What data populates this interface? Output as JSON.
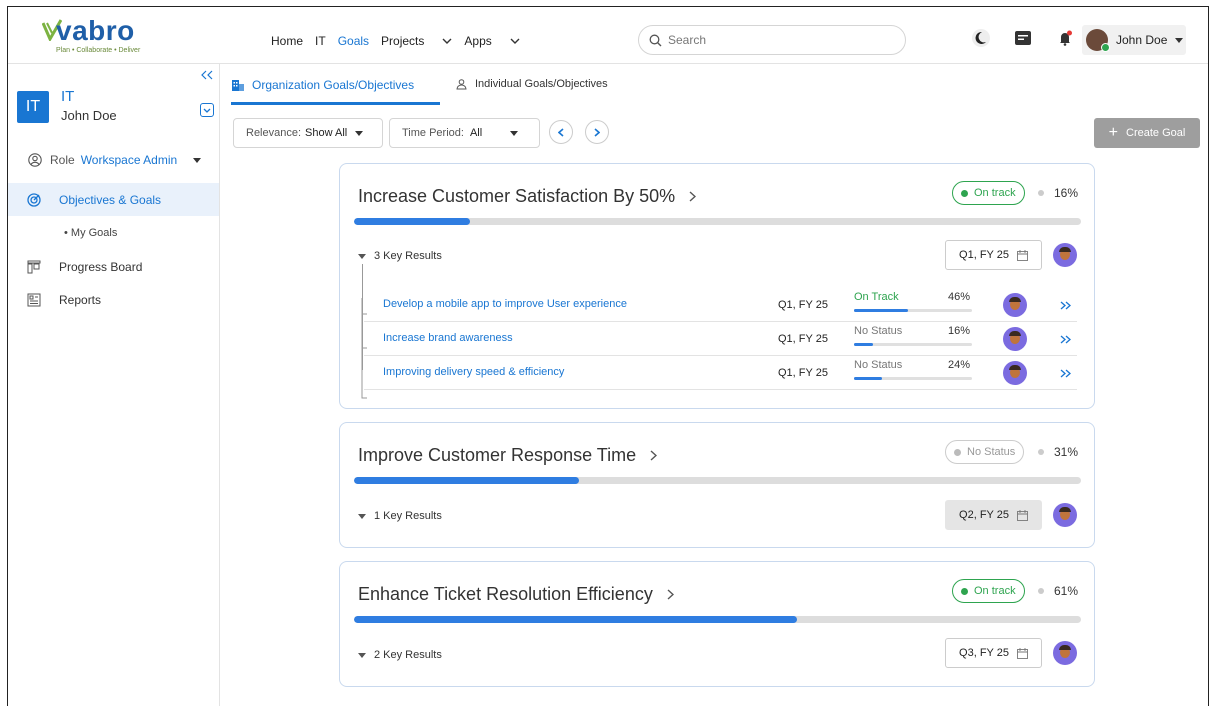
{
  "brand": {
    "name": "vabro",
    "tagline": "Plan • Collaborate • Deliver"
  },
  "nav": {
    "items": [
      {
        "label": "Home"
      },
      {
        "label": "IT"
      },
      {
        "label": "Goals"
      },
      {
        "label": "Projects"
      },
      {
        "label": "Apps"
      }
    ]
  },
  "search": {
    "placeholder": "Search"
  },
  "user": {
    "name": "John Doe"
  },
  "sidebar": {
    "workspace_badge": "IT",
    "workspace_name": "IT",
    "workspace_user": "John Doe",
    "role_label": "Role",
    "role_value": "Workspace Admin",
    "items": [
      {
        "label": "Objectives & Goals"
      },
      {
        "label": "• My Goals"
      },
      {
        "label": "Progress Board"
      },
      {
        "label": "Reports"
      }
    ]
  },
  "tabs": [
    {
      "label": "Organization Goals/Objectives"
    },
    {
      "label": "Individual Goals/Objectives"
    }
  ],
  "filters": {
    "relevance_label": "Relevance:",
    "relevance_value": "Show All",
    "time_label": "Time Period:",
    "time_value": "All"
  },
  "create_goal": "Create Goal",
  "goals": [
    {
      "title": "Increase Customer Satisfaction By 50%",
      "status": "On track",
      "percent": "16%",
      "progress": 0.16,
      "key_results_label": "3 Key Results",
      "quarter": "Q1, FY 25",
      "key_results": [
        {
          "name": "Develop a mobile app to improve User experience",
          "quarter": "Q1, FY 25",
          "status": "On Track",
          "percent": "46%",
          "progress": 0.46
        },
        {
          "name": "Increase brand awareness",
          "quarter": "Q1, FY 25",
          "status": "No Status",
          "percent": "16%",
          "progress": 0.16
        },
        {
          "name": "Improving delivery speed & efficiency",
          "quarter": "Q1, FY 25",
          "status": "No Status",
          "percent": "24%",
          "progress": 0.24
        }
      ]
    },
    {
      "title": "Improve Customer Response Time",
      "status": "No Status",
      "percent": "31%",
      "progress": 0.31,
      "key_results_label": "1 Key Results",
      "quarter": "Q2, FY 25"
    },
    {
      "title": "Enhance Ticket Resolution Efficiency",
      "status": "On track",
      "percent": "61%",
      "progress": 0.61,
      "key_results_label": "2 Key Results",
      "quarter": "Q3, FY 25"
    }
  ],
  "colors": {
    "accent": "#1976d2",
    "on_track": "#2ea44f",
    "progress": "#2f7de1",
    "no_status": "#999999"
  }
}
